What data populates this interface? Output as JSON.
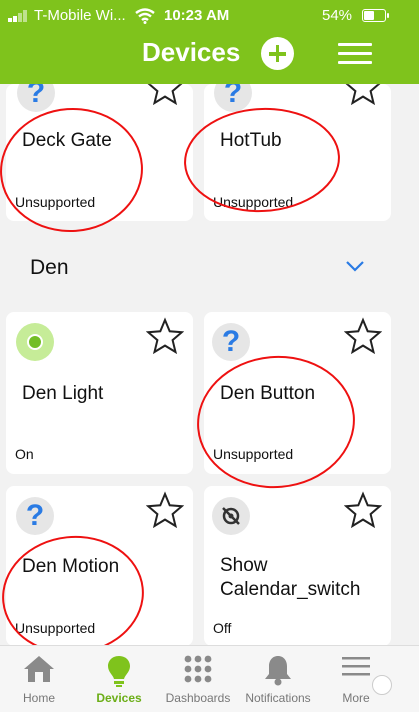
{
  "status_bar": {
    "carrier": "T-Mobile Wi...",
    "time": "10:23 AM",
    "battery": "54%",
    "battery_level": 0.54
  },
  "header": {
    "title": "Devices"
  },
  "cards_top": [
    {
      "name": "Deck Gate",
      "state": "Unsupported"
    },
    {
      "name": "HotTub",
      "state": "Unsupported"
    }
  ],
  "section": {
    "title": "Den"
  },
  "den_cards": [
    {
      "name": "Den Light",
      "state": "On"
    },
    {
      "name": "Den Button",
      "state": "Unsupported"
    },
    {
      "name": "Den Motion",
      "state": "Unsupported"
    },
    {
      "name_line1": "Show",
      "name_line2": "Calendar_switch",
      "state": "Off"
    }
  ],
  "bottom_nav": [
    {
      "label": "Home"
    },
    {
      "label": "Devices"
    },
    {
      "label": "Dashboards"
    },
    {
      "label": "Notifications"
    },
    {
      "label": "More"
    }
  ],
  "colors": {
    "header_green": "#7fc31c",
    "active_green": "#6cae18",
    "question_blue": "#2a7be4",
    "annotation_red": "#ee1111"
  }
}
